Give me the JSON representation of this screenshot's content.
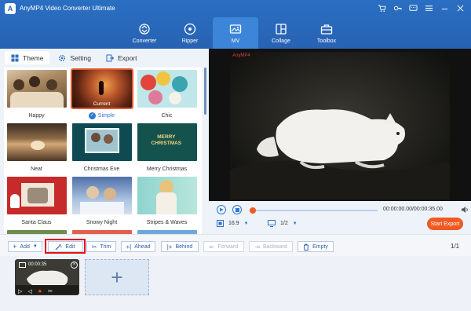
{
  "app": {
    "title": "AnyMP4 Video Converter Ultimate",
    "logo_text": "A",
    "window_controls": [
      "cart-icon",
      "key-icon",
      "feedback-icon",
      "menu-icon",
      "minimize-icon",
      "close-icon"
    ]
  },
  "nav": {
    "items": [
      {
        "label": "Converter",
        "icon": "converter-icon",
        "active": false
      },
      {
        "label": "Ripper",
        "icon": "ripper-icon",
        "active": false
      },
      {
        "label": "MV",
        "icon": "mv-icon",
        "active": true
      },
      {
        "label": "Collage",
        "icon": "collage-icon",
        "active": false
      },
      {
        "label": "Toolbox",
        "icon": "toolbox-icon",
        "active": false
      }
    ]
  },
  "left_tabs": [
    {
      "label": "Theme",
      "icon": "grid-icon",
      "active": true
    },
    {
      "label": "Setting",
      "icon": "gear-icon",
      "active": false
    },
    {
      "label": "Export",
      "icon": "export-icon",
      "active": false
    }
  ],
  "themes": [
    {
      "label": "Happy",
      "selected": false
    },
    {
      "label": "Simple",
      "selected": true,
      "badge": "Current"
    },
    {
      "label": "Chic",
      "selected": false
    },
    {
      "label": "Neat",
      "selected": false
    },
    {
      "label": "Christmas Eve",
      "selected": false
    },
    {
      "label": "Merry Christmas",
      "selected": false,
      "thumb_text": "MERRY\nCHRISTMAS"
    },
    {
      "label": "Santa Claus",
      "selected": false
    },
    {
      "label": "Snowy Night",
      "selected": false
    },
    {
      "label": "Stripes & Waves",
      "selected": false
    },
    {
      "label": "",
      "selected": false
    },
    {
      "label": "",
      "selected": false
    },
    {
      "label": "",
      "selected": false
    }
  ],
  "preview": {
    "watermark": "AnyMP4"
  },
  "player": {
    "time_display": "00:00:00.00/00:00:35.00",
    "progress": 0.0,
    "aspect_ratio": "16:9",
    "page_index": "1/2",
    "start_export_label": "Start Export"
  },
  "toolbar": {
    "add": "Add",
    "edit": "Edit",
    "trim": "Trim",
    "ahead": "Ahead",
    "behind": "Behind",
    "forward": "Forward",
    "backward": "Backward",
    "empty": "Empty",
    "page_count": "1/1"
  },
  "timeline": {
    "clip_duration": "00:00:35"
  }
}
